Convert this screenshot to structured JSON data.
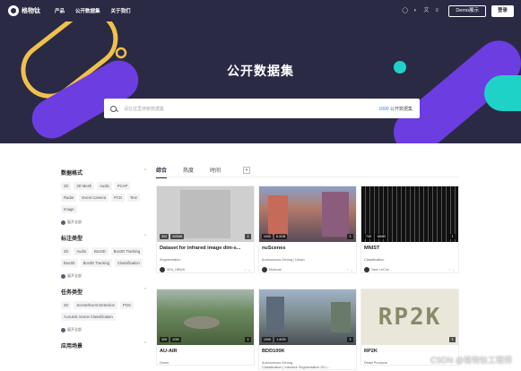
{
  "nav": {
    "logo": "格物钛",
    "links": [
      "产品",
      "公开数据集",
      "关于我们"
    ],
    "demo_label": "Demo展示",
    "login_label": "登录"
  },
  "hero": {
    "title": "公开数据集",
    "search_placeholder": "请在这里搜索数据集",
    "search_count": "1000",
    "search_suffix": "公开数据集"
  },
  "sidebar": {
    "sections": [
      {
        "title": "数据格式",
        "tags": [
          "2D",
          "3D Mesh",
          "Audio",
          "PCAP",
          "Radar",
          "Event Camera",
          "PCD",
          "Text",
          "Image"
        ],
        "more": "展开全部"
      },
      {
        "title": "标注类型",
        "tags": [
          "2D",
          "Audio",
          "Box3D",
          "Box2D Tracking",
          "Box3D",
          "Box3D Tracking",
          "Classification"
        ],
        "more": "展开全部"
      },
      {
        "title": "任务类型",
        "tags": [
          "2D",
          "Scene/Event Detection",
          "POS",
          "Acoustic Scene Classification"
        ],
        "more": "展开全部"
      },
      {
        "title": "应用场景",
        "tags": [],
        "more": ""
      }
    ]
  },
  "tabs": [
    "综合",
    "热度",
    "时间"
  ],
  "cards": [
    {
      "title": "Dataset for infrared image dim-s...",
      "sub": "Segmentation",
      "author": "SEU_HBWU",
      "stats": [
        "394",
        "300MB"
      ],
      "bg": "#c9c9c9"
    },
    {
      "title": "nuScenes",
      "sub": "Autonomous Driving | Urban",
      "author": "Motional",
      "stats": [
        "1000",
        "6.3GB"
      ],
      "bg": "#7a6a8a"
    },
    {
      "title": "MNIST",
      "sub": "Classification",
      "author": "Yann LeCun",
      "stats": [
        "70K",
        "18MB"
      ],
      "bg": "#1a1a1a"
    },
    {
      "title": "AU-AIR",
      "sub": "Drone",
      "author": "",
      "stats": [
        "32K",
        "2GB"
      ],
      "bg": "#5e7a55"
    },
    {
      "title": "BDD100K",
      "sub": "Autonomous Driving",
      "sub2": "Classification | Instance Segmentation 2D L...",
      "author": "",
      "stats": [
        "100K",
        "1.8GB"
      ],
      "bg": "#6b7b8c"
    },
    {
      "title": "RP2K",
      "sub": "Retail Products",
      "author": "",
      "stats": [
        "",
        ""
      ],
      "bg": "#e9e6da",
      "thumb_text": "RP2K"
    }
  ],
  "watermark": "CSDN @格物钛工程师",
  "colors": {
    "nav_bg": "#2b2a45",
    "accent_yellow": "#f0c14b",
    "accent_purple": "#6c3de0",
    "accent_teal": "#1fd2c8"
  }
}
